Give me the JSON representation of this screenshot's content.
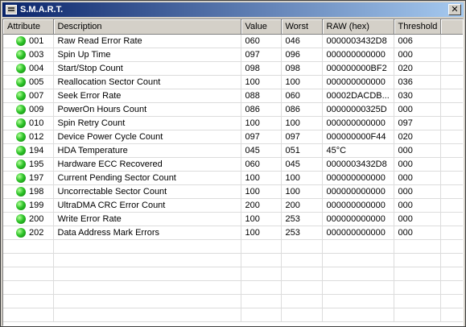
{
  "window": {
    "title": "S.M.A.R.T.",
    "close_label": "✕"
  },
  "columns": [
    "Attribute",
    "Description",
    "Value",
    "Worst",
    "RAW (hex)",
    "Threshold"
  ],
  "rows": [
    {
      "id": "001",
      "description": "Raw Read Error Rate",
      "value": "060",
      "worst": "046",
      "raw": "0000003432D8",
      "threshold": "006",
      "status": "ok"
    },
    {
      "id": "003",
      "description": "Spin Up Time",
      "value": "097",
      "worst": "096",
      "raw": "000000000000",
      "threshold": "000",
      "status": "ok"
    },
    {
      "id": "004",
      "description": "Start/Stop Count",
      "value": "098",
      "worst": "098",
      "raw": "000000000BF2",
      "threshold": "020",
      "status": "ok"
    },
    {
      "id": "005",
      "description": "Reallocation Sector Count",
      "value": "100",
      "worst": "100",
      "raw": "000000000000",
      "threshold": "036",
      "status": "ok"
    },
    {
      "id": "007",
      "description": "Seek Error Rate",
      "value": "088",
      "worst": "060",
      "raw": "00002DACDB...",
      "threshold": "030",
      "status": "ok"
    },
    {
      "id": "009",
      "description": "PowerOn Hours Count",
      "value": "086",
      "worst": "086",
      "raw": "00000000325D",
      "threshold": "000",
      "status": "ok"
    },
    {
      "id": "010",
      "description": "Spin Retry Count",
      "value": "100",
      "worst": "100",
      "raw": "000000000000",
      "threshold": "097",
      "status": "ok"
    },
    {
      "id": "012",
      "description": "Device Power Cycle Count",
      "value": "097",
      "worst": "097",
      "raw": "000000000F44",
      "threshold": "020",
      "status": "ok"
    },
    {
      "id": "194",
      "description": "HDA Temperature",
      "value": "045",
      "worst": "051",
      "raw": "45°C",
      "threshold": "000",
      "status": "ok"
    },
    {
      "id": "195",
      "description": "Hardware ECC Recovered",
      "value": "060",
      "worst": "045",
      "raw": "0000003432D8",
      "threshold": "000",
      "status": "ok"
    },
    {
      "id": "197",
      "description": "Current Pending Sector Count",
      "value": "100",
      "worst": "100",
      "raw": "000000000000",
      "threshold": "000",
      "status": "ok"
    },
    {
      "id": "198",
      "description": "Uncorrectable Sector Count",
      "value": "100",
      "worst": "100",
      "raw": "000000000000",
      "threshold": "000",
      "status": "ok"
    },
    {
      "id": "199",
      "description": "UltraDMA CRC Error Count",
      "value": "200",
      "worst": "200",
      "raw": "000000000000",
      "threshold": "000",
      "status": "ok"
    },
    {
      "id": "200",
      "description": "Write Error Rate",
      "value": "100",
      "worst": "253",
      "raw": "000000000000",
      "threshold": "000",
      "status": "ok"
    },
    {
      "id": "202",
      "description": "Data Address Mark Errors",
      "value": "100",
      "worst": "253",
      "raw": "000000000000",
      "threshold": "000",
      "status": "ok"
    }
  ],
  "status_icon": "green-ok-dot-icon",
  "colors": {
    "title_gradient_start": "#0a246a",
    "title_gradient_end": "#a6caf0",
    "status_ok": "#2fc52a",
    "window_face": "#d4d0c8"
  }
}
